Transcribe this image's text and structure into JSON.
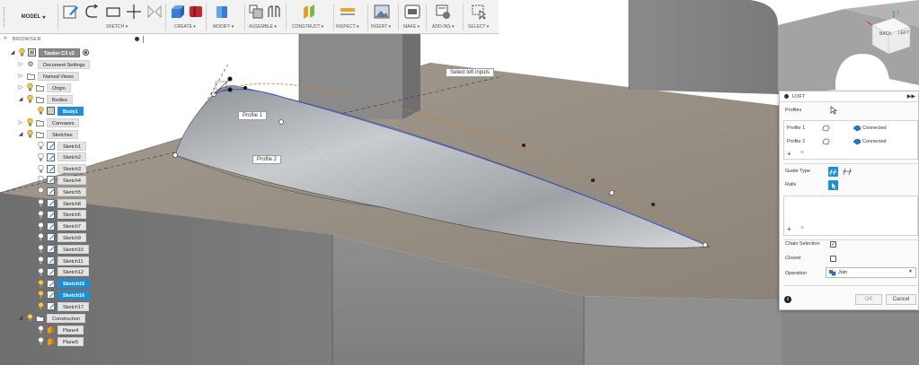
{
  "toolbar": {
    "mode_label": "MODEL",
    "groups": [
      {
        "label": "SKETCH ▾"
      },
      {
        "label": "CREATE ▾"
      },
      {
        "label": "MODIFY ▾"
      },
      {
        "label": "ASSEMBLE ▾"
      },
      {
        "label": "CONSTRUCT ▾"
      },
      {
        "label": "INSPECT ▾"
      },
      {
        "label": "INSERT ▾"
      },
      {
        "label": "MAKE ▾"
      },
      {
        "label": "ADD-INS ▾"
      },
      {
        "label": "SELECT ▾"
      }
    ]
  },
  "browser": {
    "title": "BROWSER",
    "collapse_icon": "double-left-arrow-icon",
    "root_label": "Tanker C3 v2",
    "items": [
      {
        "label": "Document Settings",
        "icon": "gear-icon"
      },
      {
        "label": "Named Views",
        "icon": "folder-icon"
      },
      {
        "label": "Origin",
        "icon": "folder-icon"
      },
      {
        "label": "Bodies",
        "icon": "folder-icon"
      },
      {
        "label": "Body1",
        "icon": "body-icon"
      },
      {
        "label": "Canvases",
        "icon": "folder-icon"
      },
      {
        "label": "Sketches",
        "icon": "folder-icon"
      }
    ],
    "sketches": [
      {
        "label": "Sketch1"
      },
      {
        "label": "Sketch2"
      },
      {
        "label": "Sketch3"
      },
      {
        "label": "Sketch4"
      },
      {
        "label": "Sketch5"
      },
      {
        "label": "Sketch8"
      },
      {
        "label": "Sketch6"
      },
      {
        "label": "Sketch7"
      },
      {
        "label": "Sketch9"
      },
      {
        "label": "Sketch10"
      },
      {
        "label": "Sketch11"
      },
      {
        "label": "Sketch12"
      },
      {
        "label": "Sketch15"
      },
      {
        "label": "Sketch16"
      },
      {
        "label": "Sketch17"
      }
    ],
    "construction_label": "Construction",
    "planes": [
      {
        "label": "Plane4"
      },
      {
        "label": "Plane5"
      }
    ]
  },
  "viewport": {
    "tooltip": "Select loft inputs",
    "profile1_label": "Profile 1",
    "profile2_label": "Profile 2"
  },
  "viewcube": {
    "back_label": "BACK",
    "left_label": "LEFT",
    "axis_label": "Z"
  },
  "loft": {
    "title": "LOFT",
    "profiles_label": "Profiles",
    "rows": [
      {
        "name": "Profile 1",
        "status": "Connected"
      },
      {
        "name": "Profile 2",
        "status": "Connected"
      }
    ],
    "guide_type_label": "Guide Type",
    "rails_label": "Rails",
    "chain_selection_label": "Chain Selection",
    "chain_selection_checked": true,
    "closed_label": "Closed",
    "closed_checked": false,
    "operation_label": "Operation",
    "operation_value": "Join",
    "ok_label": "OK",
    "cancel_label": "Cancel",
    "add_symbol": "+",
    "remove_symbol": "×"
  }
}
